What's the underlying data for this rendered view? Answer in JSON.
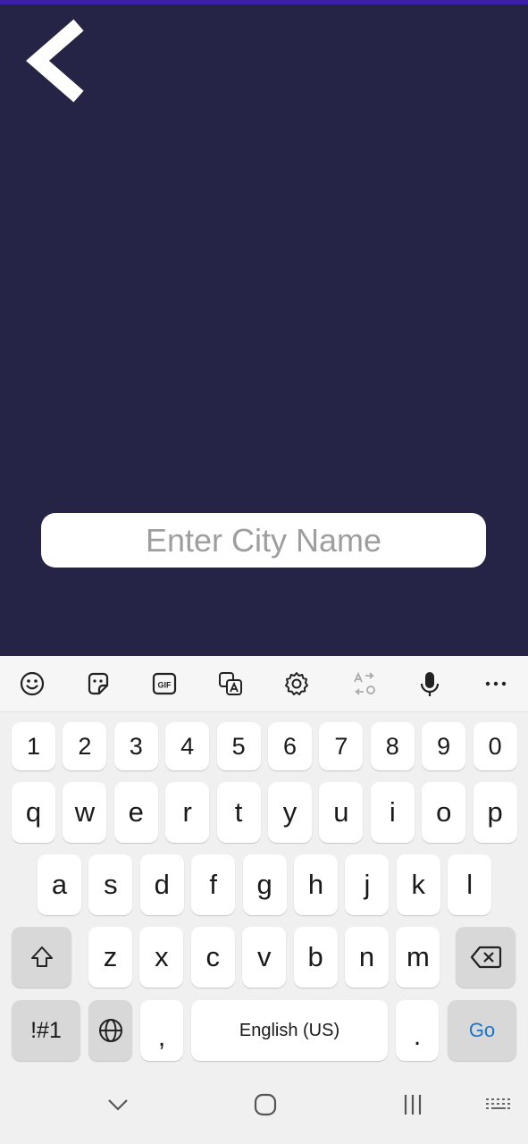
{
  "app": {
    "city_input": {
      "placeholder": "Enter City Name",
      "value": ""
    }
  },
  "colors": {
    "background": "#252446",
    "input_background": "#ffffff",
    "keyboard_background": "#f0f0f0",
    "go_key_text": "#1a73c9"
  },
  "keyboard": {
    "toolbar_icons": [
      "emoji-icon",
      "sticker-icon",
      "gif-icon",
      "translate-icon",
      "settings-icon",
      "text-conversion-icon",
      "microphone-icon",
      "more-icon"
    ],
    "number_row": [
      "1",
      "2",
      "3",
      "4",
      "5",
      "6",
      "7",
      "8",
      "9",
      "0"
    ],
    "row1": [
      "q",
      "w",
      "e",
      "r",
      "t",
      "y",
      "u",
      "i",
      "o",
      "p"
    ],
    "row2": [
      "a",
      "s",
      "d",
      "f",
      "g",
      "h",
      "j",
      "k",
      "l"
    ],
    "row3": [
      "z",
      "x",
      "c",
      "v",
      "b",
      "n",
      "m"
    ],
    "symbols_label": "!#1",
    "comma_label": ",",
    "space_label": "English (US)",
    "period_label": ".",
    "go_label": "Go"
  },
  "navbar": {
    "icons": [
      "hide-keyboard-icon",
      "home-icon",
      "recents-icon",
      "keyboard-switch-icon"
    ]
  }
}
